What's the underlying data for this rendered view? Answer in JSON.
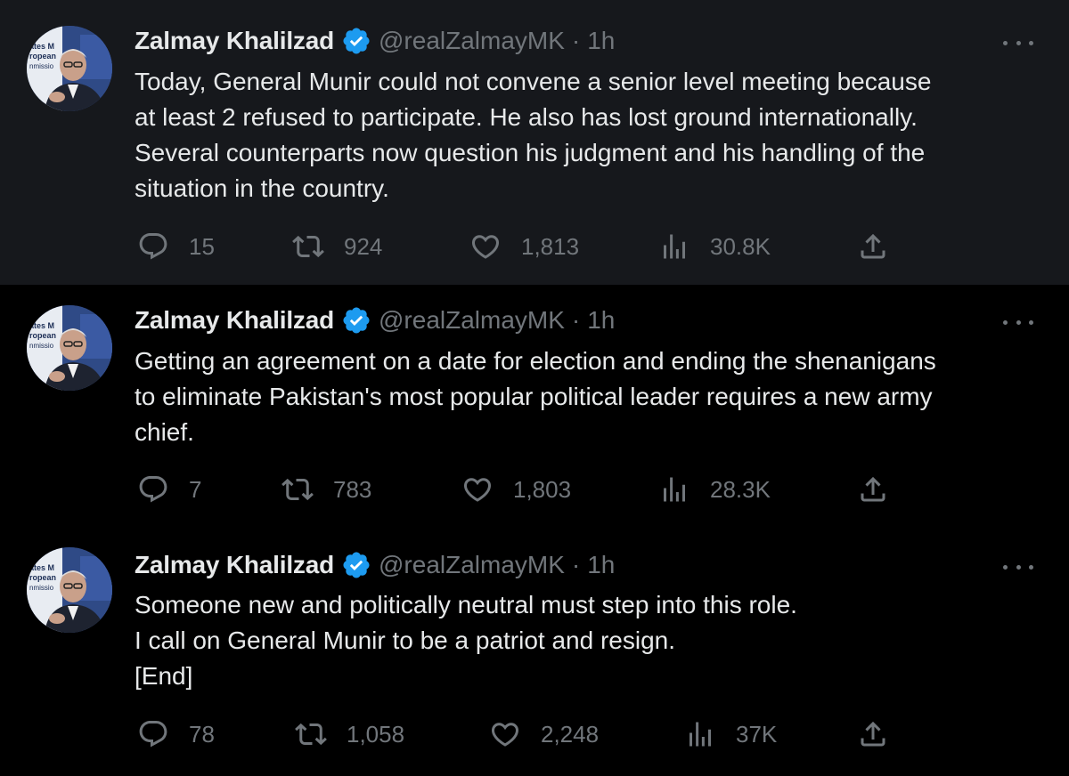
{
  "author": {
    "name": "Zalmay Khalilzad",
    "handle": "@realZalmayMK",
    "separator": "·",
    "avatar_banner_lines": [
      "ates M",
      "ropean",
      "nmissio"
    ]
  },
  "tweets": [
    {
      "time": "1h",
      "text": "Today, General Munir could not convene a senior level meeting because\nat least 2 refused to participate. He also has lost ground internationally.\nSeveral counterparts now question his judgment and his handling of the\nsituation in the country.",
      "replies": "15",
      "retweets": "924",
      "likes": "1,813",
      "views": "30.8K"
    },
    {
      "time": "1h",
      "text": "Getting an agreement on a date for election and ending the  shenanigans\nto eliminate Pakistan's most popular political leader requires a new army\nchief.",
      "replies": "7",
      "retweets": "783",
      "likes": "1,803",
      "views": "28.3K"
    },
    {
      "time": "1h",
      "text": "Someone new and politically neutral must step into this role.\nI call on General Munir to be a patriot and resign.\n[End]",
      "replies": "78",
      "retweets": "1,058",
      "likes": "2,248",
      "views": "37K"
    }
  ],
  "icons": {
    "reply": "reply-icon",
    "retweet": "retweet-icon",
    "like": "like-icon",
    "views": "views-icon",
    "share": "share-icon",
    "more": "more-options-icon",
    "verified": "verified-badge-icon"
  },
  "colors": {
    "background": "#000000",
    "highlighted_background": "#16181c",
    "text": "#e7e9ea",
    "secondary_text": "#71767b",
    "verified": "#1d9bf0"
  }
}
